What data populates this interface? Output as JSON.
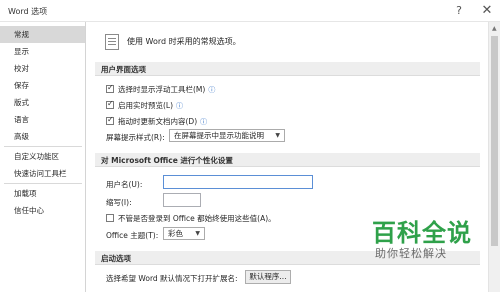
{
  "window": {
    "title": "Word 选项",
    "help_label": "?",
    "close_label": "✕"
  },
  "sidebar": {
    "items": [
      {
        "label": "常规"
      },
      {
        "label": "显示"
      },
      {
        "label": "校对"
      },
      {
        "label": "保存"
      },
      {
        "label": "版式"
      },
      {
        "label": "语言"
      },
      {
        "label": "高级"
      },
      {
        "label": "自定义功能区"
      },
      {
        "label": "快速访问工具栏"
      },
      {
        "label": "加载项"
      },
      {
        "label": "信任中心"
      }
    ]
  },
  "main": {
    "header": "使用 Word 时采用的常规选项。",
    "ui_section": {
      "title": "用户界面选项",
      "options": [
        {
          "label": "选择时显示浮动工具栏(M)",
          "checked": true
        },
        {
          "label": "启用实时预览(L)",
          "checked": true
        },
        {
          "label": "拖动时更新文档内容(D)",
          "checked": true
        }
      ],
      "tooltip_style_label": "屏幕提示样式(R):",
      "tooltip_style_value": "在屏幕提示中显示功能说明",
      "dropdown_arrow": "▼"
    },
    "personalize_section": {
      "title": "对 Microsoft Office 进行个性化设置",
      "username_label": "用户名(U):",
      "username_value": "",
      "initials_label": "缩写(I):",
      "initials_value": "",
      "always_use_label": "不管是否登录到 Office 都始终使用这些值(A)。",
      "always_use_checked": false,
      "theme_label": "Office 主题(T):",
      "theme_value": "彩色"
    },
    "startup_section": {
      "title": "启动选项",
      "default_ext_label": "选择希望 Word 默认情况下打开扩展名:",
      "default_programs_button": "默认程序..."
    }
  },
  "watermark": {
    "title": "百科全说",
    "subtitle": "助你轻松解决"
  },
  "info_icon": "ⓘ",
  "scroll_up": "▲"
}
